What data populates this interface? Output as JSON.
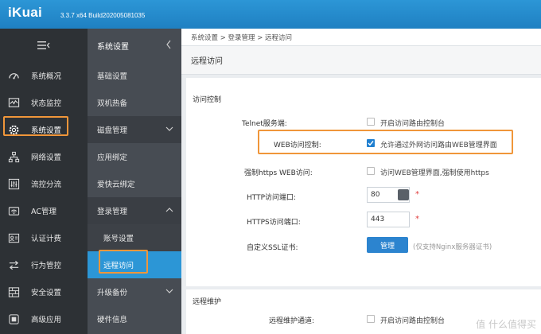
{
  "header": {
    "logo": "iKuai",
    "version": "3.3.7 x64 Build202005081035"
  },
  "sidebar": {
    "items": [
      {
        "label": "系统概况",
        "icon": "dashboard-icon"
      },
      {
        "label": "状态监控",
        "icon": "monitor-icon"
      },
      {
        "label": "系统设置",
        "icon": "gear-icon"
      },
      {
        "label": "网络设置",
        "icon": "network-icon"
      },
      {
        "label": "流控分流",
        "icon": "sliders-icon"
      },
      {
        "label": "AC管理",
        "icon": "wifi-icon"
      },
      {
        "label": "认证计费",
        "icon": "id-card-icon"
      },
      {
        "label": "行为管控",
        "icon": "arrows-icon"
      },
      {
        "label": "安全设置",
        "icon": "firewall-icon"
      },
      {
        "label": "高级应用",
        "icon": "apps-icon"
      }
    ]
  },
  "submenu": {
    "title": "系统设置",
    "items": [
      {
        "label": "基础设置"
      },
      {
        "label": "双机热备"
      },
      {
        "label": "磁盘管理"
      },
      {
        "label": "应用绑定"
      },
      {
        "label": "爱快云绑定"
      },
      {
        "label": "登录管理"
      },
      {
        "label": "账号设置"
      },
      {
        "label": "远程访问"
      },
      {
        "label": "升级备份"
      },
      {
        "label": "硬件信息"
      }
    ]
  },
  "breadcrumb": "系统设置 > 登录管理 > 远程访问",
  "page_title": "远程访问",
  "access_control": {
    "title": "访问控制",
    "telnet_label": "Telnet服务端:",
    "telnet_text": "开启访问路由控制台",
    "web_label": "WEB访问控制:",
    "web_text": "允许通过外网访问路由WEB管理界面",
    "https_label": "强制https WEB访问:",
    "https_text": "访问WEB管理界面,强制使用https",
    "http_port_label": "HTTP访问端口:",
    "http_port_value": "80",
    "https_port_label": "HTTPS访问端口:",
    "https_port_value": "443",
    "ssl_label": "自定义SSL证书:",
    "ssl_button": "管理",
    "ssl_hint": "(仅支持Nginx服务器证书)"
  },
  "remote_maintenance": {
    "title": "远程维护",
    "channel_label": "远程维护通道:",
    "channel_text": "开启访问路由控制台"
  },
  "watermark": "值 什么值得买",
  "colors": {
    "header": "#2c96d6",
    "sidebar": "#2d3135",
    "submenu": "#474c53",
    "active": "#2c96d6",
    "highlight": "#f0963a"
  }
}
